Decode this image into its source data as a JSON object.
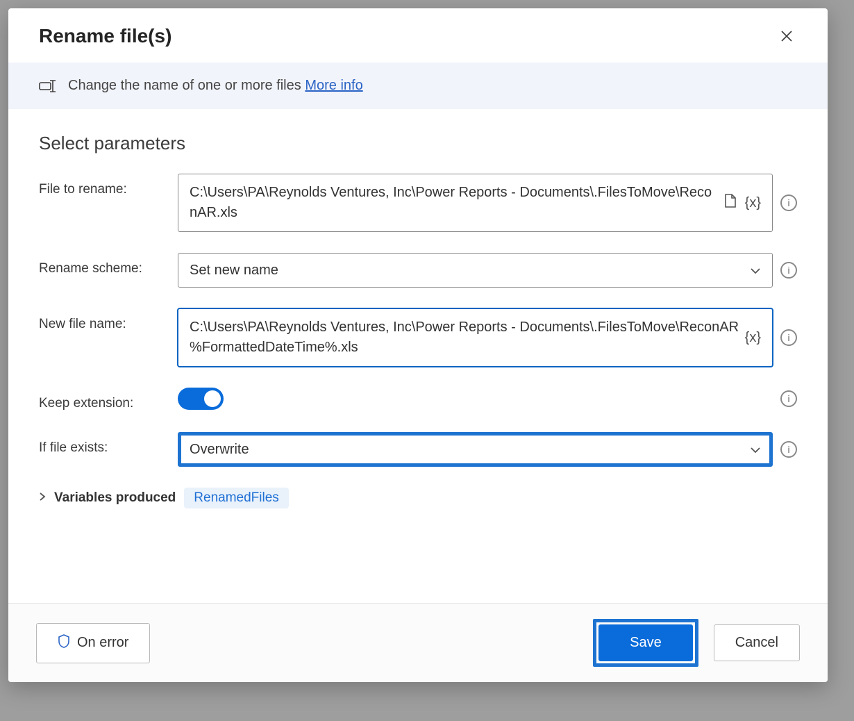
{
  "dialog": {
    "title": "Rename file(s)",
    "description": "Change the name of one or more files",
    "moreInfo": "More info",
    "sectionTitle": "Select parameters"
  },
  "params": {
    "fileToRename": {
      "label": "File to rename:",
      "value": "C:\\Users\\PA\\Reynolds Ventures, Inc\\Power Reports - Documents\\.FilesToMove\\ReconAR.xls"
    },
    "renameScheme": {
      "label": "Rename scheme:",
      "value": "Set new name"
    },
    "newFileName": {
      "label": "New file name:",
      "value": "C:\\Users\\PA\\Reynolds Ventures, Inc\\Power Reports - Documents\\.FilesToMove\\ReconAR %FormattedDateTime%.xls"
    },
    "keepExtension": {
      "label": "Keep extension:",
      "value": true
    },
    "ifFileExists": {
      "label": "If file exists:",
      "value": "Overwrite"
    }
  },
  "variablesProduced": {
    "label": "Variables produced",
    "chip": "RenamedFiles"
  },
  "footer": {
    "onError": "On error",
    "save": "Save",
    "cancel": "Cancel"
  },
  "icons": {
    "varToken": "{x}"
  }
}
